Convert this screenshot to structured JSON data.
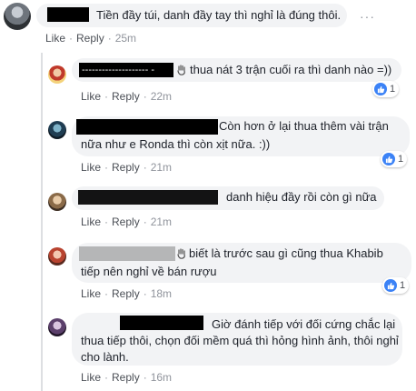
{
  "actions": {
    "like_label": "Like",
    "reply_label": "Reply",
    "separator": "·"
  },
  "icons": {
    "like_reaction": "thumbs-up-icon",
    "more": "more-options-icon",
    "hand": "waving-hand-icon"
  },
  "colors": {
    "bubble": "#f2f3f5",
    "like_blue": "#3b82f6",
    "action_text": "#90949c"
  },
  "comments": [
    {
      "text": "Tiền đầy túi, danh đầy tay thì nghỉ là đúng thôi.",
      "time": "25m"
    },
    {
      "name_fragment": "-------------------- -",
      "text": "thua nát 3 trận cuối ra thì danh nào =))",
      "time": "22m",
      "reactions": "1"
    },
    {
      "text_line1": "Còn hơn ở lại thua thêm vài trận",
      "text_line2": "nữa như e Ronda thì còn xịt nữa. :))",
      "time": "21m",
      "reactions": "1"
    },
    {
      "text": "danh hiệu đầy rồi còn gì nữa",
      "time": "21m"
    },
    {
      "text_line1": "biết là trước sau gì cũng thua Khabib",
      "text_line2": "tiếp nên nghỉ về bán rượu",
      "time": "18m",
      "reactions": "1"
    },
    {
      "text_line1": "Giờ đánh tiếp với đối cứng chắc lại",
      "text_line2": "thua tiếp thôi, chọn đối mềm quá thì hỏng hình ảnh, thôi nghỉ",
      "text_line3": "cho lành.",
      "time": "16m"
    }
  ]
}
